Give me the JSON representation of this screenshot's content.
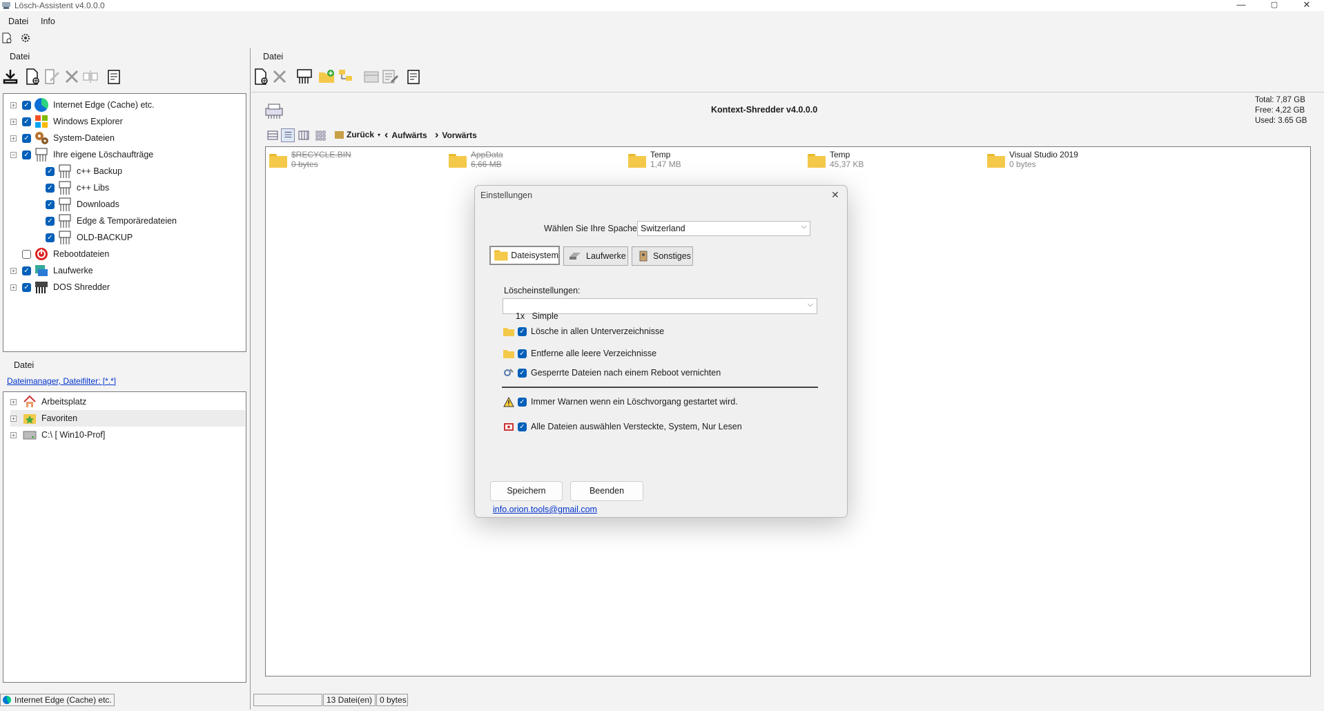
{
  "window": {
    "title": "Lösch-Assistent v4.0.0.0",
    "min": "—",
    "max": "▢",
    "close": "✕"
  },
  "menu": [
    "Datei",
    "Info"
  ],
  "left_panel": {
    "label": "Datei",
    "tree": [
      {
        "label": "Internet  Edge (Cache) etc.",
        "icon": "edge-icon",
        "checked": true,
        "expander": "+"
      },
      {
        "label": "Windows Explorer",
        "icon": "windows-icon",
        "checked": true,
        "expander": "+"
      },
      {
        "label": "System-Dateien",
        "icon": "gears-icon",
        "checked": true,
        "expander": "+"
      },
      {
        "label": "Ihre eigene Löschaufträge",
        "icon": "shredder-icon",
        "checked": true,
        "expander": "−"
      },
      {
        "label": "c++ Backup",
        "icon": "shredder-icon",
        "checked": true,
        "child": true
      },
      {
        "label": "c++ Libs",
        "icon": "shredder-icon",
        "checked": true,
        "child": true
      },
      {
        "label": "Downloads",
        "icon": "shredder-icon",
        "checked": true,
        "child": true
      },
      {
        "label": "Edge & Temporäredateien",
        "icon": "shredder-icon",
        "checked": true,
        "child": true
      },
      {
        "label": "OLD-BACKUP",
        "icon": "shredder-icon",
        "checked": true,
        "child": true
      },
      {
        "label": "Rebootdateien",
        "icon": "reboot-icon",
        "checked": false
      },
      {
        "label": "Laufwerke",
        "icon": "drives-icon",
        "checked": true,
        "expander": "+"
      },
      {
        "label": "DOS Shredder",
        "icon": "dos-shredder-icon",
        "checked": true,
        "expander": "+"
      }
    ]
  },
  "bottom_left": {
    "label": "Datei",
    "filter_link": "Dateimanager, Dateifilter:    [*.*]",
    "tree": [
      {
        "label": "Arbeitsplatz",
        "icon": "home-icon"
      },
      {
        "label": "Favoriten",
        "icon": "favorites-icon"
      },
      {
        "label": "C:\\ [ Win10-Prof]",
        "icon": "drive-icon"
      }
    ]
  },
  "status_left": "Internet  Edge (Cache) etc.",
  "right_panel": {
    "label": "Datei",
    "header_title": "Kontext-Shredder v4.0.0.0",
    "disk": {
      "total": "Total:  7,87 GB",
      "free": "Free:   4,22 GB",
      "used": "Used:  3.65 GB"
    },
    "nav": {
      "back": "Zurück",
      "up": "Aufwärts",
      "forward": "Vorwärts"
    },
    "files": [
      {
        "name": "$RECYCLE.BIN",
        "size": "0 bytes",
        "struck": true
      },
      {
        "name": "AppData",
        "size": "6,66 MB",
        "struck": true
      },
      {
        "name": "Temp",
        "size": "1,47 MB",
        "struck": false
      },
      {
        "name": "Temp",
        "size": "45,37 KB",
        "struck": false
      },
      {
        "name": "Visual Studio 2019",
        "size": "0 bytes",
        "struck": false
      }
    ],
    "status_count": "13  Datei(en)",
    "status_bytes": "0 bytes"
  },
  "dialog": {
    "title": "Einstellungen",
    "language_label": "Wählen Sie Ihre Spache:",
    "language_value": "Switzerland",
    "tabs": [
      "Dateisystem",
      "Laufwerke",
      "Sonstiges"
    ],
    "delete_settings_label": "Löscheinstellungen:",
    "delete_mode": "1x   Simple",
    "options": [
      {
        "label": "Lösche in allen Unterverzeichnisse",
        "icon": "folder-icon"
      },
      {
        "label": "Entferne alle leere Verzeichnisse",
        "icon": "folder-icon"
      },
      {
        "label": "Gesperrte Dateien nach einem Reboot vernichten",
        "icon": "reboot-tool-icon"
      },
      {
        "label": "Immer Warnen wenn ein Löschvorgang gestartet wird.",
        "icon": "warning-icon"
      },
      {
        "label": "Alle Dateien auswählen Versteckte, System, Nur Lesen",
        "icon": "files-icon"
      }
    ],
    "save": "Speichern",
    "quit": "Beenden",
    "email": "info.orion.tools@gmail.com",
    "close": "✕"
  },
  "colors": {
    "accent": "#005fb8",
    "folder": "#f4c94a",
    "link": "#0033cc"
  }
}
